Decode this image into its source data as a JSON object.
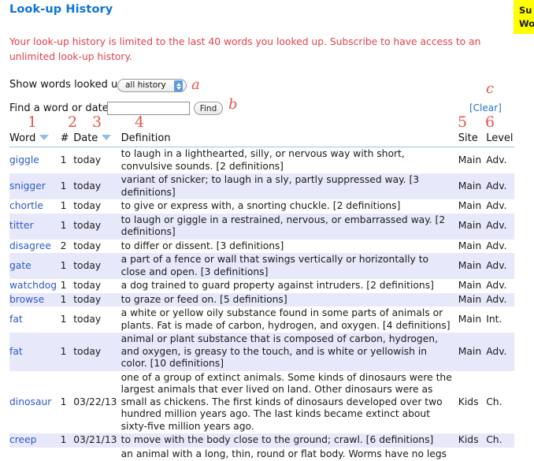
{
  "promo": {
    "line1": "Su",
    "line2": "Wo",
    "bg": "#ffff00"
  },
  "page": {
    "title": "Look-up History",
    "title_color": "#0a74d8",
    "notice": "Your look-up history is limited to the last 40 words you looked up. Subscribe to have access to an unlimited look-up history.",
    "notice_color": "#e0414b"
  },
  "controls": {
    "show_label": "Show words looked up",
    "filter_selected": "all history",
    "find_label": "Find a word or date",
    "find_value": "",
    "find_placeholder": "",
    "find_button": "Find",
    "clear_link": "[Clear]"
  },
  "annotations": {
    "a": "a",
    "b": "b",
    "c": "c",
    "n1": "1",
    "n2": "2",
    "n3": "3",
    "n4": "4",
    "n5": "5",
    "n6": "6"
  },
  "table": {
    "headers": {
      "word": "Word",
      "count": "#",
      "date": "Date",
      "definition": "Definition",
      "site": "Site",
      "level": "Level"
    },
    "rows": [
      {
        "word": "giggle",
        "count": "1",
        "date": "today",
        "definition": "to laugh in a lighthearted, silly, or nervous way with short, convulsive sounds. [2 definitions]",
        "site": "Main",
        "level": "Adv."
      },
      {
        "word": "snigger",
        "count": "1",
        "date": "today",
        "definition": "variant of snicker; to laugh in a sly, partly suppressed way. [3 definitions]",
        "site": "Main",
        "level": "Adv."
      },
      {
        "word": "chortle",
        "count": "1",
        "date": "today",
        "definition": "to give or express with, a snorting chuckle. [2 definitions]",
        "site": "Main",
        "level": "Adv."
      },
      {
        "word": "titter",
        "count": "1",
        "date": "today",
        "definition": "to laugh or giggle in a restrained, nervous, or embarrassed way. [2 definitions]",
        "site": "Main",
        "level": "Adv."
      },
      {
        "word": "disagree",
        "count": "2",
        "date": "today",
        "definition": "to differ or dissent. [3 definitions]",
        "site": "Main",
        "level": "Adv."
      },
      {
        "word": "gate",
        "count": "1",
        "date": "today",
        "definition": "a part of a fence or wall that swings vertically or horizontally to close and open. [3 definitions]",
        "site": "Main",
        "level": "Adv."
      },
      {
        "word": "watchdog",
        "count": "1",
        "date": "today",
        "definition": "a dog trained to guard property against intruders. [2 definitions]",
        "site": "Main",
        "level": "Adv."
      },
      {
        "word": "browse",
        "count": "1",
        "date": "today",
        "definition": "to graze or feed on. [5 definitions]",
        "site": "Main",
        "level": "Adv."
      },
      {
        "word": "fat",
        "count": "1",
        "date": "today",
        "definition": "a white or yellow oily substance found in some parts of animals or plants. Fat is made of carbon, hydrogen, and oxygen. [4 definitions]",
        "site": "Main",
        "level": "Int."
      },
      {
        "word": "fat",
        "count": "1",
        "date": "today",
        "definition": "animal or plant substance that is composed of carbon, hydrogen, and oxygen, is greasy to the touch, and is white or yellowish in color. [10 definitions]",
        "site": "Main",
        "level": "Adv."
      },
      {
        "word": "dinosaur",
        "count": "1",
        "date": "03/22/13",
        "definition": "one of a group of extinct animals. Some kinds of dinosaurs were the largest animals that ever lived on land. Other dinosaurs were as small as chickens. The first kinds of dinosaurs developed over two hundred million years ago. The last kinds became extinct about sixty-five million years ago.",
        "site": "Kids",
        "level": "Ch."
      },
      {
        "word": "creep",
        "count": "1",
        "date": "03/21/13",
        "definition": "to move with the body close to the ground; crawl. [6 definitions]",
        "site": "Kids",
        "level": "Ch."
      },
      {
        "word": "",
        "count": "",
        "date": "",
        "definition": "an animal with a long, thin, round or flat body. Worms have no legs",
        "site": "",
        "level": ""
      }
    ]
  }
}
